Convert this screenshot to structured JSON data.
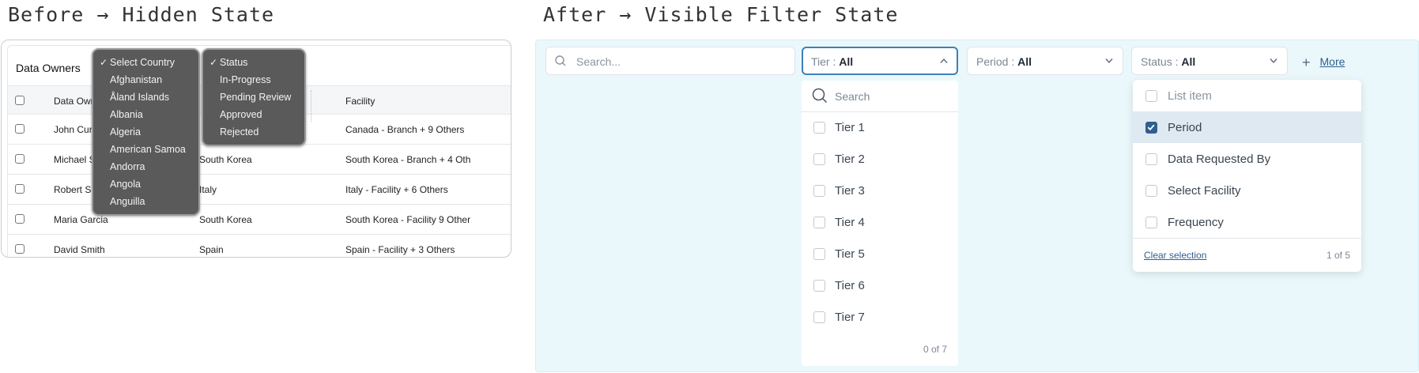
{
  "headings": {
    "before": "Before → Hidden State",
    "after": "After → Visible Filter State"
  },
  "before_panel": {
    "title": "Data Owners",
    "columns": [
      "Data Owner",
      "",
      "Facility"
    ],
    "rows": [
      {
        "owner": "John Cur",
        "country": "",
        "facility": "Canada - Branch + 9 Others"
      },
      {
        "owner": "Michael S",
        "country": "South Korea",
        "facility": "South Korea - Branch + 4 Oth"
      },
      {
        "owner": "Robert S",
        "country": "Italy",
        "facility": "Italy - Facility + 6 Others"
      },
      {
        "owner": "Maria Garcia",
        "country": "South Korea",
        "facility": "South Korea - Facility 9 Other"
      },
      {
        "owner": "David Smith",
        "country": "Spain",
        "facility": "Spain - Facility + 3 Others"
      }
    ],
    "country_popup": {
      "items": [
        "Select Country",
        "Afghanistan",
        "Åland Islands",
        "Albania",
        "Algeria",
        "American Samoa",
        "Andorra",
        "Angola",
        "Anguilla"
      ],
      "selected": "Select Country"
    },
    "status_popup": {
      "items": [
        "Status",
        "In-Progress",
        "Pending Review",
        "Approved",
        "Rejected"
      ],
      "selected": "Status"
    }
  },
  "after_panel": {
    "search_placeholder": "Search...",
    "filters": [
      {
        "label": "Tier :",
        "value": "All",
        "open": true
      },
      {
        "label": "Period :",
        "value": "All",
        "open": false
      },
      {
        "label": "Status :",
        "value": "All",
        "open": false
      }
    ],
    "more_label": "More",
    "more_icon": "plus-icon",
    "tier_dropdown": {
      "search_placeholder": "Search",
      "options": [
        "Tier 1",
        "Tier 2",
        "Tier 3",
        "Tier 4",
        "Tier 5",
        "Tier 6",
        "Tier 7"
      ],
      "count": "0 of 7"
    },
    "more_dropdown": {
      "options": [
        {
          "label": "List item",
          "checked": false
        },
        {
          "label": "Period",
          "checked": true
        },
        {
          "label": "Data Requested By",
          "checked": false
        },
        {
          "label": "Select Facility",
          "checked": false
        },
        {
          "label": "Frequency",
          "checked": false
        }
      ],
      "clear_label": "Clear selection",
      "count": "1 of 5"
    },
    "colors": {
      "panel_bg": "#eaf8fc",
      "accent": "#2f5f8f",
      "active_border": "#3f7fb8"
    }
  }
}
